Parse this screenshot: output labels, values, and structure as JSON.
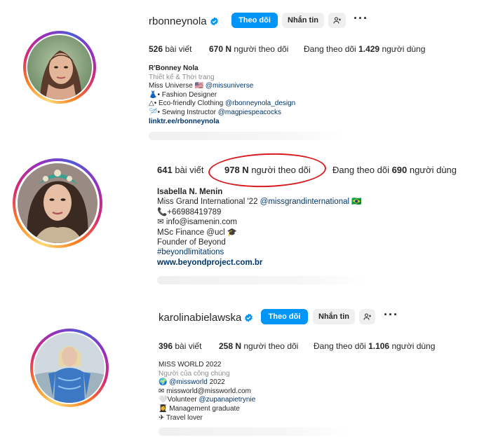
{
  "profiles": [
    {
      "username": "rbonneynola",
      "verified": true,
      "follow_label": "Theo dõi",
      "message_label": "Nhắn tin",
      "posts_count": "526",
      "posts_label": "bài viết",
      "followers_count": "670 N",
      "followers_label": "người theo dõi",
      "following_prefix": "Đang theo dõi",
      "following_count": "1.429",
      "following_suffix": "người dùng",
      "bio": {
        "name": "R'Bonney Nola",
        "category": "Thiết kế & Thời trang",
        "line1_text": "Miss Universe ",
        "line1_link": "@missuniverse",
        "line2": "• Fashion Designer",
        "line3_text": "△• Eco-friendly Clothing ",
        "line3_link": "@rbonneynola_design",
        "line4_text": "• Sewing Instructor ",
        "line4_link": "@magpiespeacocks",
        "url": "linktr.ee/rbonneynola"
      }
    },
    {
      "posts_count": "641",
      "posts_label": "bài viết",
      "followers_count": "978 N",
      "followers_label": "người theo dõi",
      "following_prefix": "Đang theo dõi",
      "following_count": "690",
      "following_suffix": "người dùng",
      "bio": {
        "name": "Isabella N. Menin",
        "line1_text": "Miss Grand International '22 ",
        "line1_link": "@missgrandinternational",
        "line2": "+66988419789",
        "line3": "info@isamenin.com",
        "line4": "MSc Finance @ucl",
        "line5": "Founder of Beyond",
        "hashtag": "#beyondlimitations",
        "url": "www.beyondproject.com.br"
      }
    },
    {
      "username": "karolinabielawska",
      "verified": true,
      "follow_label": "Theo dõi",
      "message_label": "Nhắn tin",
      "posts_count": "396",
      "posts_label": "bài viết",
      "followers_count": "258 N",
      "followers_label": "người theo dõi",
      "following_prefix": "Đang theo dõi",
      "following_count": "1.106",
      "following_suffix": "người dùng",
      "bio": {
        "name": "MISS WORLD 2022",
        "category": "Người của công chúng",
        "line1_text": "",
        "line1_link": "@missworld",
        "line1_after": " 2022",
        "line2": "missworld@missworld.com",
        "line3_text": "Volunteer ",
        "line3_link": "@zupanapietrynie",
        "line4": "Management graduate",
        "line5": "Travel lover"
      }
    }
  ],
  "icons": {
    "verified": "verified-badge-icon",
    "add_user": "add-person-icon",
    "more": "more-options-icon"
  },
  "colors": {
    "follow_button": "#0095f6",
    "link": "#00376b",
    "highlight_circle": "#d9191e"
  }
}
